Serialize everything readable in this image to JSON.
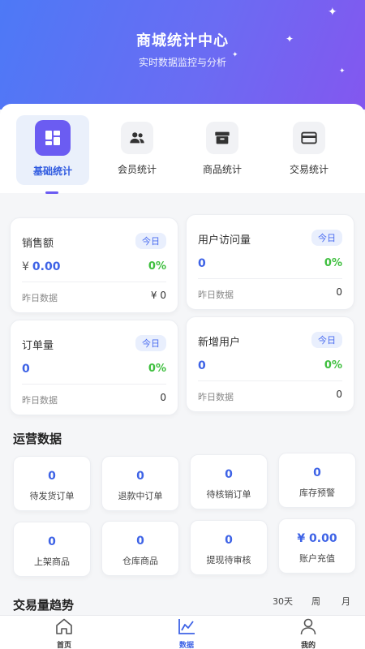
{
  "header": {
    "title": "商城统计中心",
    "subtitle": "实时数据监控与分析"
  },
  "tabs": [
    {
      "label": "基础统计",
      "icon": "dashboard-grid-icon",
      "active": true
    },
    {
      "label": "会员统计",
      "icon": "people-icon",
      "active": false
    },
    {
      "label": "商品统计",
      "icon": "archive-box-icon",
      "active": false
    },
    {
      "label": "交易统计",
      "icon": "credit-card-icon",
      "active": false
    }
  ],
  "stats": {
    "sales": {
      "title": "销售额",
      "badge": "今日",
      "currency": "¥",
      "value": "0.00",
      "percent": "0%",
      "yesterday_label": "昨日数据",
      "yesterday_value": "¥ 0"
    },
    "visits": {
      "title": "用户访问量",
      "badge": "今日",
      "value": "0",
      "percent": "0%",
      "yesterday_label": "昨日数据",
      "yesterday_value": "0"
    },
    "orders": {
      "title": "订单量",
      "badge": "今日",
      "value": "0",
      "percent": "0%",
      "yesterday_label": "昨日数据",
      "yesterday_value": "0"
    },
    "new_users": {
      "title": "新增用户",
      "badge": "今日",
      "value": "0",
      "percent": "0%",
      "yesterday_label": "昨日数据",
      "yesterday_value": "0"
    }
  },
  "operations": {
    "title": "运营数据",
    "items": [
      {
        "value": "0",
        "label": "待发货订单"
      },
      {
        "value": "0",
        "label": "退款中订单"
      },
      {
        "value": "0",
        "label": "待核销订单"
      },
      {
        "value": "0",
        "label": "库存预警"
      },
      {
        "value": "0",
        "label": "上架商品"
      },
      {
        "value": "0",
        "label": "仓库商品"
      },
      {
        "value": "0",
        "label": "提现待审核"
      },
      {
        "value": "¥ 0.00",
        "label": "账户充值"
      }
    ]
  },
  "trend": {
    "title": "交易量趋势",
    "periods": [
      "30天",
      "周",
      "月"
    ]
  },
  "bottom_nav": [
    {
      "label": "首页",
      "icon": "home-icon",
      "active": false
    },
    {
      "label": "数据",
      "icon": "line-chart-icon",
      "active": true
    },
    {
      "label": "我的",
      "icon": "user-icon",
      "active": false
    }
  ],
  "colors": {
    "accent": "#3e63e6",
    "accent_purple": "#6b5cf2",
    "positive": "#3fbf3f",
    "header_start": "#4d79f6",
    "header_end": "#8357ef"
  }
}
